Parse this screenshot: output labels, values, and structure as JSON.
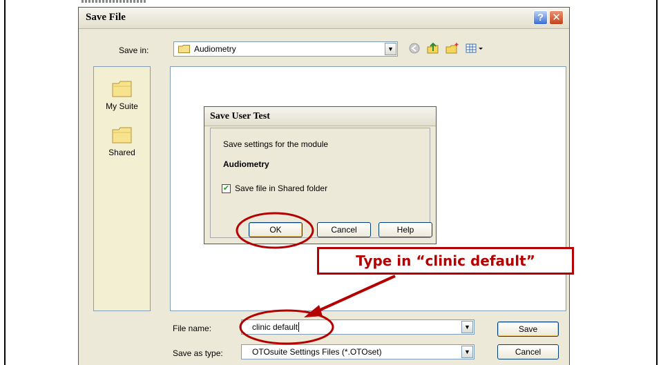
{
  "save_file_dialog": {
    "title": "Save File",
    "help_glyph": "?",
    "close_glyph": "✕",
    "save_in_label": "Save in:",
    "save_in_value": "Audiometry",
    "places": [
      {
        "label": "My Suite"
      },
      {
        "label": "Shared"
      }
    ],
    "file_name_label": "File name:",
    "file_name_value": "clinic default",
    "save_as_type_label": "Save as type:",
    "save_as_type_value": "OTOsuite Settings Files (*.OTOset)",
    "save_button": "Save",
    "cancel_button": "Cancel"
  },
  "save_user_test_dialog": {
    "title": "Save User Test",
    "description": "Save settings for the module",
    "module": "Audiometry",
    "checkbox_label": "Save file in Shared folder",
    "checkbox_checked": true,
    "ok_button": "OK",
    "cancel_button": "Cancel",
    "help_button": "Help"
  },
  "annotation": {
    "callout_text": "Type in “clinic default”",
    "color": "#b40000"
  }
}
